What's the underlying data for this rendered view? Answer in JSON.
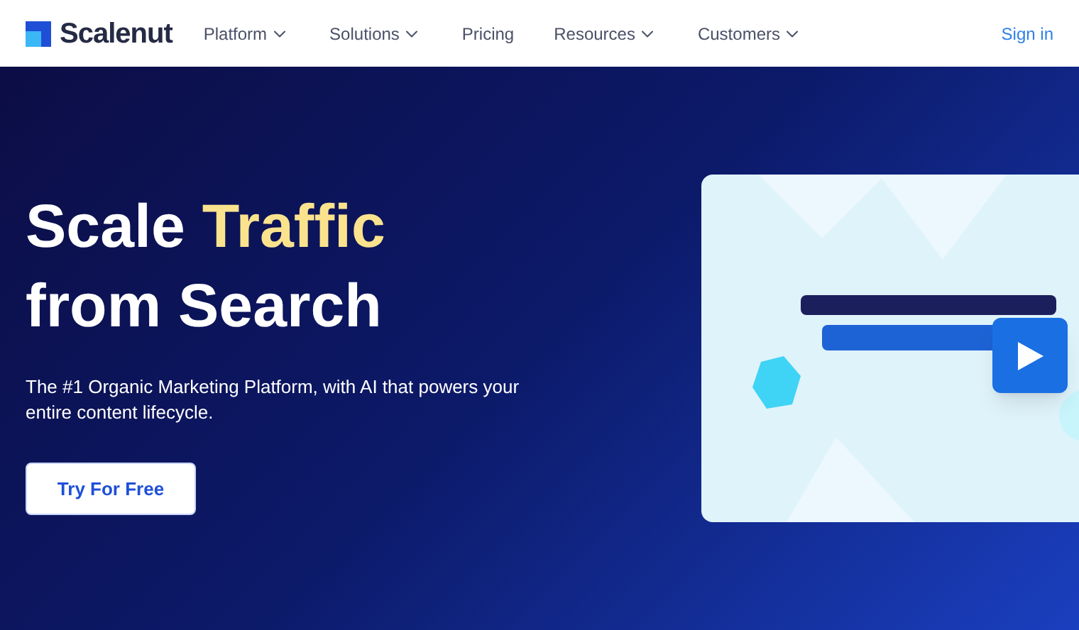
{
  "header": {
    "brand": "Scalenut",
    "nav": [
      {
        "label": "Platform",
        "has_dropdown": true
      },
      {
        "label": "Solutions",
        "has_dropdown": true
      },
      {
        "label": "Pricing",
        "has_dropdown": false
      },
      {
        "label": "Resources",
        "has_dropdown": true
      },
      {
        "label": "Customers",
        "has_dropdown": true
      }
    ],
    "sign_in": "Sign in"
  },
  "hero": {
    "title_start": "Scale",
    "title_highlight": "Traffic",
    "title_end": "from Search",
    "subtitle": "The #1 Organic Marketing Platform, with AI that powers your entire content lifecycle.",
    "cta": "Try For Free"
  }
}
